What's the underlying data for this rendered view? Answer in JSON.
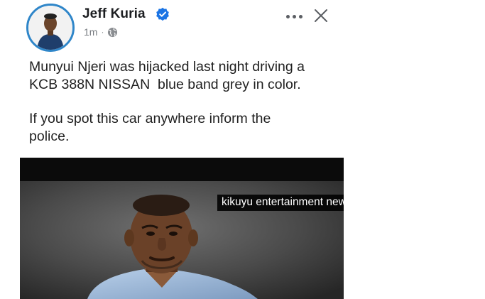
{
  "post": {
    "author": {
      "name": "Jeff Kuria",
      "verified": true
    },
    "meta": {
      "time": "1m",
      "separator": "·",
      "audience_icon": "globe-icon"
    },
    "actions": {
      "more_icon": "more-horizontal-icon",
      "close_icon": "close-icon"
    },
    "text": {
      "line1": "Munyui Njeri was hijacked last night driving a",
      "line2": "KCB 388N NISSAN  blue band grey in color.",
      "line3": "If you spot this car anywhere inform the",
      "line4": "police."
    },
    "media": {
      "watermark": "kikuyu entertainment news"
    }
  },
  "colors": {
    "badge": "#1b74e4",
    "avatar_ring": "#2f86c9",
    "meta_text": "#777b80",
    "body_text": "#1f1f1f"
  }
}
